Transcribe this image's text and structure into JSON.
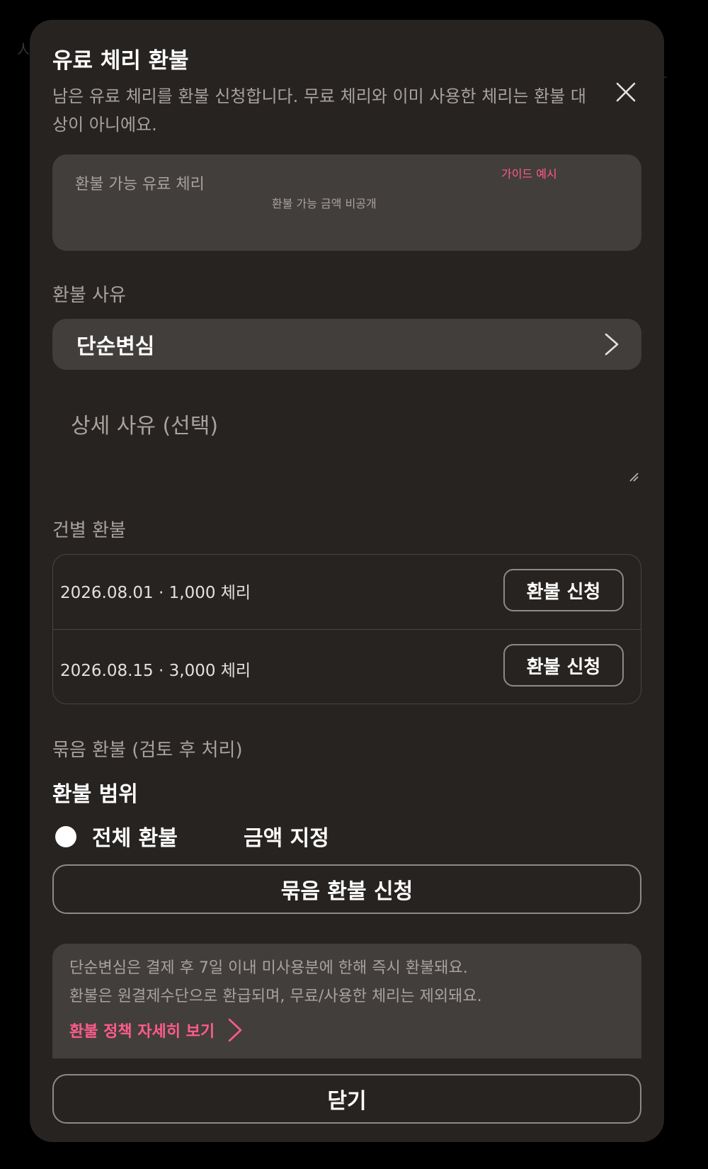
{
  "background": {
    "partial_text": "人"
  },
  "modal": {
    "title": "유료 체리 환불",
    "description": "남은 유료 체리를 환불 신청합니다. 무료 체리와 이미 사용한 체리는 환불 대상이 아니에요.",
    "close_icon": "close-icon"
  },
  "refundable_card": {
    "label": "환불 가능 유료 체리",
    "amount_text": "환불 가능 금액 비공개",
    "guide_label": "가이드 예시"
  },
  "reason": {
    "label": "환불 사유",
    "selected": "단순변심",
    "detail_placeholder": "상세 사유 (선택)"
  },
  "individual_refund": {
    "label": "건별 환불",
    "rows": [
      {
        "text": "2026.08.01 · 1,000 체리",
        "button": "환불 신청"
      },
      {
        "text": "2026.08.15 · 3,000 체리",
        "button": "환불 신청"
      }
    ]
  },
  "bundle_refund": {
    "label": "묶음 환불 (검토 후 처리)",
    "scope_heading": "환불 범위",
    "options": [
      "전체 환불",
      "금액 지정"
    ],
    "selected_option": "전체 환불",
    "submit_label": "묶음 환불 신청"
  },
  "notice": {
    "lines": [
      "단순변심은 결제 후 7일 이내 미사용분에 한해 즉시 환불돼요.",
      "환불은 원결제수단으로 환급되며, 무료/사용한 체리는 제외돼요."
    ],
    "link_label": "환불 정책 자세히 보기"
  },
  "footer": {
    "close_label": "닫기"
  },
  "colors": {
    "background": "#000000",
    "modal": "#272321",
    "card": "#423e3c",
    "muted_text": "#a8a29f",
    "accent_pink": "#ff5c8a",
    "border": "#8e8986"
  }
}
